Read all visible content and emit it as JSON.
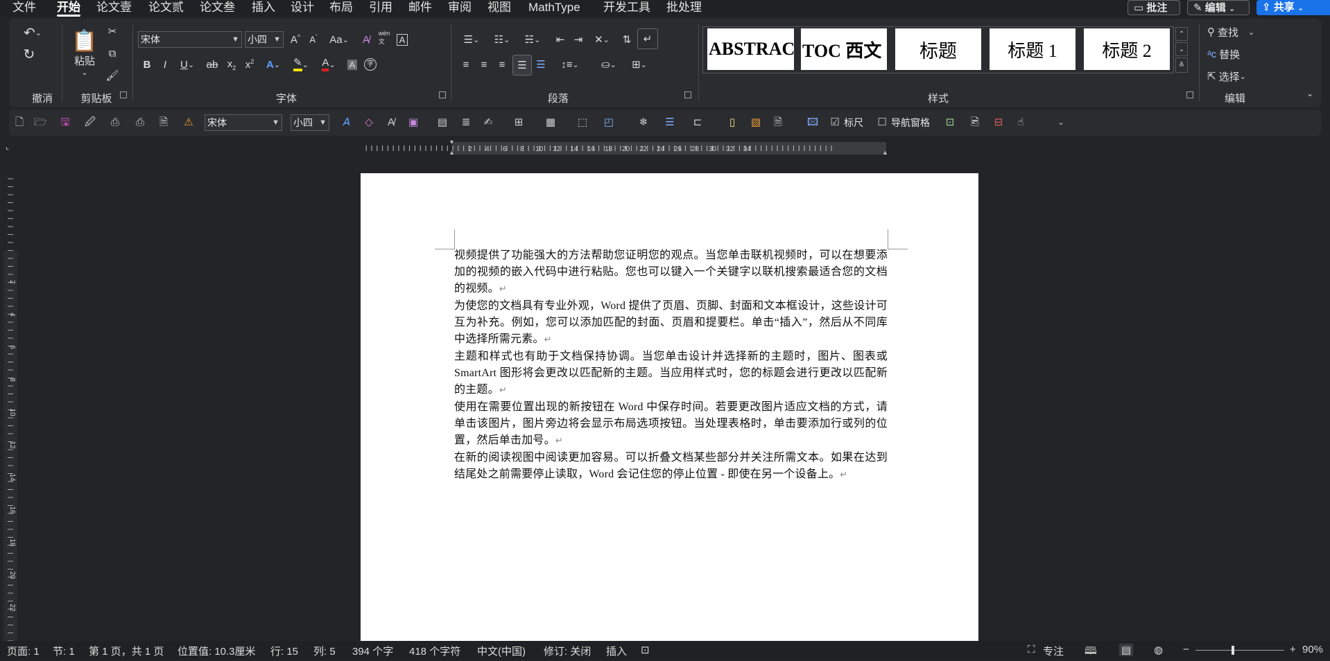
{
  "menu": {
    "tabs": [
      "文件",
      "开始",
      "论文壹",
      "论文贰",
      "论文叁",
      "插入",
      "设计",
      "布局",
      "引用",
      "邮件",
      "审阅",
      "视图",
      "MathType",
      "开发工具",
      "批处理"
    ],
    "active_tab": "开始",
    "comment_button": "批注",
    "edit_button": "编辑",
    "share_button": "共享"
  },
  "ribbon": {
    "undo_group": "撤消",
    "clipboard_group": "剪贴板",
    "paste_label": "粘贴",
    "font_group": "字体",
    "font_name": "宋体",
    "font_size": "小四",
    "paragraph_group": "段落",
    "styles_group": "样式",
    "styles": [
      "ABSTRAC",
      "TOC 西文",
      "标题",
      "标题 1",
      "标题 2"
    ],
    "edit_group": "编辑",
    "find_label": "查找",
    "replace_label": "替换",
    "select_label": "选择"
  },
  "quick_toolbar": {
    "font_name": "宋体",
    "font_size": "小四",
    "ruler_label": "标尺",
    "ruler_checked": true,
    "nav_pane_label": "导航窗格",
    "nav_pane_checked": false
  },
  "ruler": {
    "labels": [
      "2",
      "4",
      "6",
      "8",
      "10",
      "12",
      "14",
      "16",
      "18",
      "20",
      "22",
      "24",
      "26",
      "28",
      "30",
      "32",
      "34"
    ],
    "vertical_labels": [
      "2",
      "4",
      "6",
      "8",
      "10",
      "12",
      "14",
      "16",
      "18",
      "20",
      "22"
    ]
  },
  "document": {
    "paragraphs": [
      "视频提供了功能强大的方法帮助您证明您的观点。当您单击联机视频时，可以在想要添加的视频的嵌入代码中进行粘贴。您也可以键入一个关键字以联机搜索最适合您的文档的视频。",
      "为使您的文档具有专业外观，Word 提供了页眉、页脚、封面和文本框设计，这些设计可互为补充。例如，您可以添加匹配的封面、页眉和提要栏。单击“插入”，然后从不同库中选择所需元素。",
      "主题和样式也有助于文档保持协调。当您单击设计并选择新的主题时，图片、图表或 SmartArt 图形将会更改以匹配新的主题。当应用样式时，您的标题会进行更改以匹配新的主题。",
      "使用在需要位置出现的新按钮在 Word 中保存时间。若要更改图片适应文档的方式，请单击该图片，图片旁边将会显示布局选项按钮。当处理表格时，单击要添加行或列的位置，然后单击加号。",
      "在新的阅读视图中阅读更加容易。可以折叠文档某些部分并关注所需文本。如果在达到结尾处之前需要停止读取，Word 会记住您的停止位置 - 即使在另一个设备上。"
    ],
    "paragraph_mark": "↵"
  },
  "status": {
    "page": "页面: 1",
    "section": "节: 1",
    "page_of": "第 1 页，共 1 页",
    "position": "位置值: 10.3厘米",
    "line": "行: 15",
    "column": "列: 5",
    "word_count": "394 个字",
    "char_count": "418 个字符",
    "language": "中文(中国)",
    "track_changes": "修订: 关闭",
    "insert_mode": "插入",
    "focus": "专注",
    "zoom": "90%",
    "zoom_level": 0.9
  },
  "colors": {
    "accent": "#1a73e8",
    "background": "#222428",
    "ribbon": "#2b2c30"
  }
}
